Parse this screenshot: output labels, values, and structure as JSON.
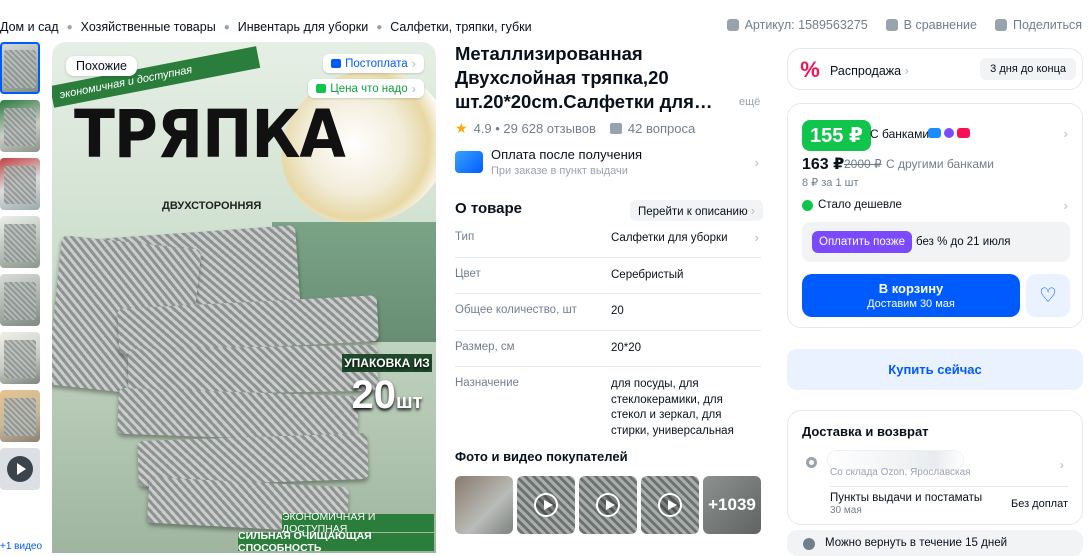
{
  "breadcrumb": [
    "Дом и сад",
    "Хозяйственные товары",
    "Инвентарь для уборки",
    "Салфетки, тряпки, губки"
  ],
  "topbar": {
    "article": "Артикул: 1589563275",
    "compare": "В сравнение",
    "share": "Поделиться"
  },
  "gallery": {
    "video_label": "+1 видео",
    "similar_button": "Похожие",
    "tag_postpay": "Постоплата",
    "tag_good_price": "Цена что надо",
    "image_text": {
      "slogan": "экономичная и доступная",
      "headline": "ТРЯПКА",
      "two_sided": "ДВУХСТОРОННЯЯ",
      "pack_line1": "УПАКОВКА ИЗ",
      "pack_count": "20",
      "pack_unit": "шт",
      "strip1": "ЭКОНОМИЧНАЯ И ДОСТУПНАЯ",
      "strip2": "СИЛЬНАЯ ОЧИЩАЮЩАЯ СПОСОБНОСТЬ"
    }
  },
  "product": {
    "title": "Металлизированная Двухслойная тряпка,20 шт.20*20cm.Салфетки для…",
    "more": "ещё",
    "rating": "4.9 • 29 628 отзывов",
    "questions": "42 вопроса",
    "payment_title": "Оплата после получения",
    "payment_sub": "При заказе в пункт выдачи",
    "about_heading": "О товаре",
    "to_description": "Перейти к описанию",
    "attributes": [
      {
        "key": "Тип",
        "value": "Салфетки для уборки"
      },
      {
        "key": "Цвет",
        "value": "Серебристый"
      },
      {
        "key": "Общее количество, шт",
        "value": "20"
      },
      {
        "key": "Размер, см",
        "value": "20*20"
      },
      {
        "key": "Назначение",
        "value": "для посуды, для стеклокерамики, для стекол и зеркал, для стирки, универсальная"
      }
    ],
    "photos_heading": "Фото и видео покупателей",
    "photos_more": "+1039"
  },
  "sale": {
    "label": "Распродажа",
    "days": "3 дня до конца"
  },
  "price": {
    "bank_price": "155 ₽",
    "bank_label": "С банками",
    "price": "163 ₽",
    "old_price": "2000 ₽",
    "other_banks": "С другими банками",
    "per_unit": "8 ₽ за 1 шт",
    "cheaper": "Стало дешевле",
    "pay_later_button": "Оплатить позже",
    "pay_later_text": "без % до 21 июля",
    "cart_button": "В корзину",
    "cart_sub": "Доставим 30 мая"
  },
  "buy_now": "Купить сейчас",
  "delivery": {
    "heading": "Доставка и возврат",
    "warehouse": "Со склада Ozon, Ярославская",
    "pickup": "Пункты выдачи и постаматы",
    "pickup_date": "30 мая",
    "pickup_cost": "Без доплат",
    "return": "Можно вернуть в течение 15 дней"
  },
  "colors": {
    "accent": "#005bff",
    "green": "#10c44c",
    "sale": "#f91155",
    "paylater": "#7b4aff"
  }
}
